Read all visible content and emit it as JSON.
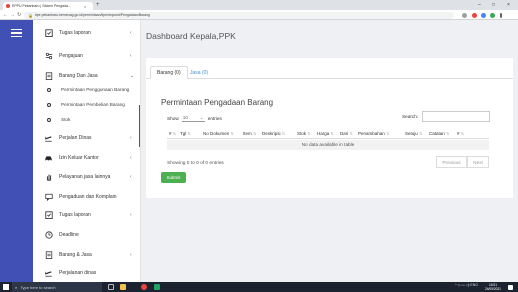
{
  "browser": {
    "tab_title": "EPPU Pekanbaru | Sistem Pengada...",
    "tab_close": "×",
    "new_tab": "+",
    "url": "tipe.pekanbaru.kemenag.go.id/permintaan/tipe/request/PengadaanBarang",
    "window_controls": [
      "–",
      "□",
      "×"
    ],
    "nav": [
      "←",
      "→",
      "↻"
    ]
  },
  "page_title": "Dashboard Kepala,PPK",
  "sidebar": {
    "items": [
      {
        "label": "Tugas laporan",
        "icon": "clipboard-check-icon",
        "chevron": "‹"
      },
      {
        "label": "Pengajuan",
        "icon": "settings-sliders-icon",
        "chevron": "‹"
      },
      {
        "label": "Barang Dan Jasa",
        "icon": "document-icon",
        "chevron": "⌄"
      },
      {
        "label": "Perjalan Dinas",
        "icon": "airplane-icon",
        "chevron": "‹"
      },
      {
        "label": "Izin Keluar Kantor",
        "icon": "car-icon",
        "chevron": "‹"
      },
      {
        "label": "Pelayanan jasa lainnya",
        "icon": "hand-icon",
        "chevron": "‹"
      },
      {
        "label": "Pengaduan dan Komplain",
        "icon": "chat-icon",
        "chevron": ""
      },
      {
        "label": "Tugas laporan",
        "icon": "clipboard-check-icon",
        "chevron": "‹"
      },
      {
        "label": "Deadline",
        "icon": "clock-icon",
        "chevron": ""
      },
      {
        "label": "Barang & Jasa",
        "icon": "document-icon",
        "chevron": "‹"
      },
      {
        "label": "Perjalanan dinas",
        "icon": "airplane-icon",
        "chevron": ""
      }
    ],
    "subitems": [
      {
        "label": "Permintaan Penggunaan Barang"
      },
      {
        "label": "Permintaan Pembelian Barang"
      },
      {
        "label": "Stok"
      }
    ]
  },
  "card": {
    "tabs": [
      "Barang (0)",
      "Jasa (0)"
    ],
    "title": "Permintaan Pengadaan Barang",
    "show_label": "Show",
    "entries_value": "10",
    "entries_label": "entries",
    "search_label": "Search:",
    "columns": [
      "#",
      "Tgl",
      "No Dokumen",
      "Item",
      "Deskripsi",
      "Stok",
      "Harga",
      "Dari",
      "Penambahan",
      "Setuju",
      "Catatan",
      "#"
    ],
    "empty_text": "No data available in table",
    "info": "Showing 0 to 0 of 0 entries",
    "previous": "Previous",
    "next": "Next",
    "submit": "Submit"
  },
  "taskbar": {
    "search_placeholder": "Type here to search",
    "tray": "^ ◇ ▭ ◁) ENG",
    "time": "16:51",
    "date": "24/05/2021"
  },
  "colors": {
    "primary": "#4050b5",
    "submit": "#4caf50",
    "tab_link": "#4a8fd8"
  }
}
